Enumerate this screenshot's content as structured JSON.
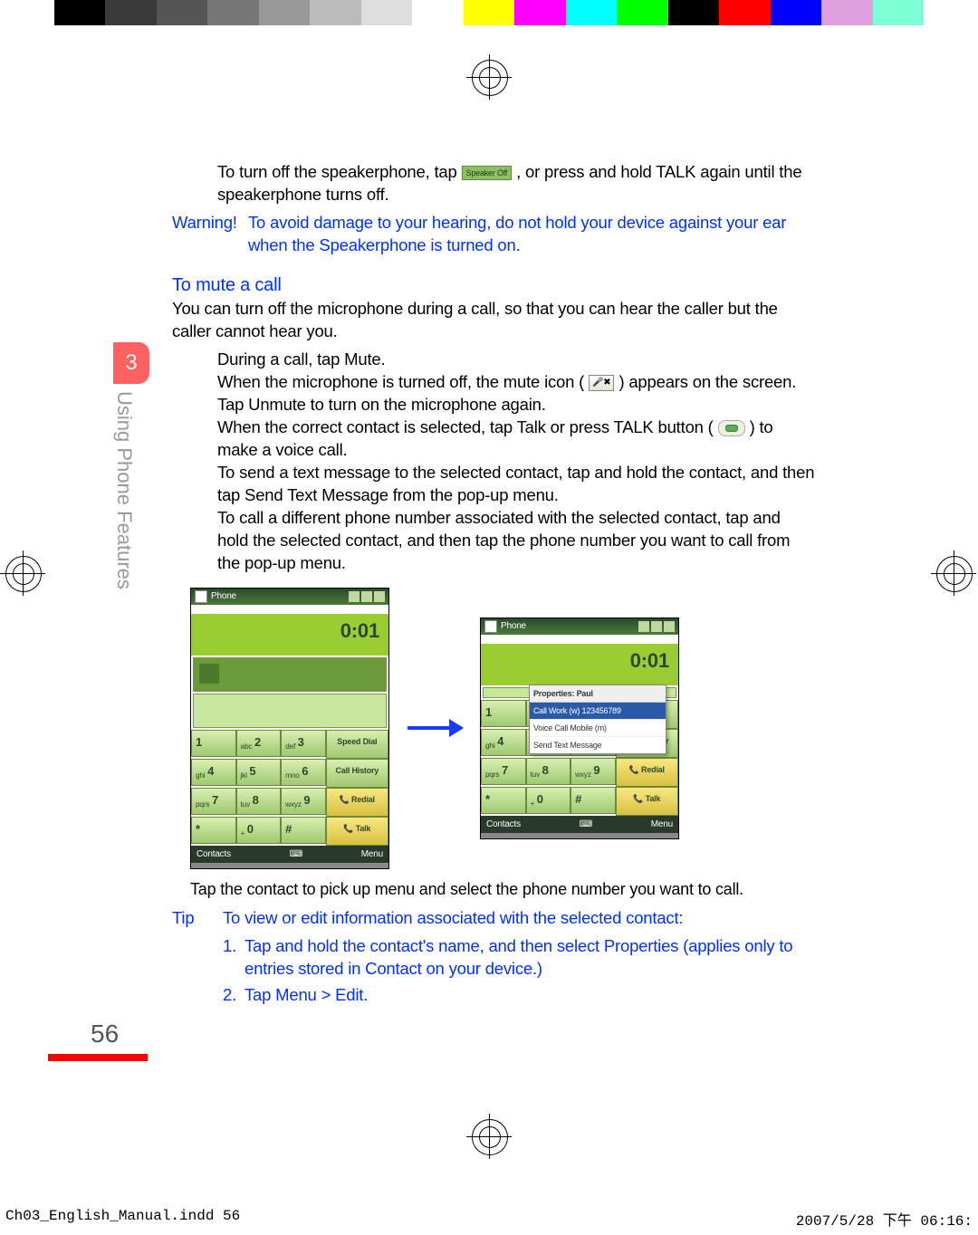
{
  "chapter": {
    "number": "3",
    "title": "Using Phone Features"
  },
  "page_number": "56",
  "para1_a": "To turn off the speakerphone, tap ",
  "para1_b": ", or press and hold TALK again until the speakerphone turns off.",
  "speaker_btn_label": "Speaker Off",
  "warning_label": "Warning!",
  "warning_text": "To avoid damage to your hearing, do not hold your device against your ear when the Speakerphone is turned on.",
  "heading_mute": "To mute a call",
  "mute_intro": "You can turn off the microphone during a call, so that you can hear the caller but the caller cannot hear you.",
  "step_during": "During a call, tap Mute.",
  "mute_para_a": "When the microphone is turned off, the mute icon ( ",
  "mute_para_b": " ) appears on the screen. Tap Unmute to turn on the microphone again.",
  "talk_para_a": "When the correct contact is selected, tap Talk or press TALK button (",
  "talk_para_b": ") to make a voice call.",
  "send_sms": "To send a text message to the selected contact, tap and hold the contact, and then tap Send Text Message from the pop-up menu.",
  "diff_number": "To call a different phone number associated with the selected contact, tap and hold the selected contact, and then tap the phone number you want to call from the pop-up menu.",
  "phone_ui": {
    "title": "Phone",
    "display": "0:01",
    "contacts_soft": "Contacts",
    "menu_soft": "Menu",
    "keys": {
      "side": [
        "Speed Dial",
        "Call History",
        "Redial",
        "Talk"
      ],
      "nums": [
        [
          "1",
          ""
        ],
        [
          "abc",
          "2"
        ],
        [
          "def",
          "3"
        ],
        [
          "ghi",
          "4"
        ],
        [
          "jkl",
          "5"
        ],
        [
          "mno",
          "6"
        ],
        [
          "pqrs",
          "7"
        ],
        [
          "tuv",
          "8"
        ],
        [
          "wxyz",
          "9"
        ],
        [
          "*",
          ""
        ],
        [
          "+",
          "0"
        ],
        [
          "#",
          ""
        ]
      ]
    },
    "popup": {
      "header": "Properties: Paul",
      "selected": "Call Work (w) 123456789",
      "items": [
        "Call Work (w) 123456789",
        "Voice Call Mobile (m)",
        "Send Text Message"
      ]
    }
  },
  "caption": "Tap the contact to pick up menu and select the phone number you want to call.",
  "tip_label": "Tip",
  "tip_intro": "To view or edit information associated with the selected contact:",
  "tip_1": "Tap and hold the contact's name, and then select Properties (applies only to entries stored in Contact on your device.)",
  "tip_2": "Tap Menu > Edit.",
  "footer": {
    "file": "Ch03_English_Manual.indd   56",
    "date": "2007/5/28   下午 06:16:"
  },
  "colorbar": [
    "#000",
    "#3a3a3a",
    "#555",
    "#777",
    "#999",
    "#bbb",
    "#ddd",
    "#fff",
    "#ffff00",
    "#ff00ff",
    "#00ffff",
    "#00ff00",
    "#000",
    "#ff0000",
    "#0000ff",
    "#e0a0e0",
    "#7fffd4"
  ]
}
